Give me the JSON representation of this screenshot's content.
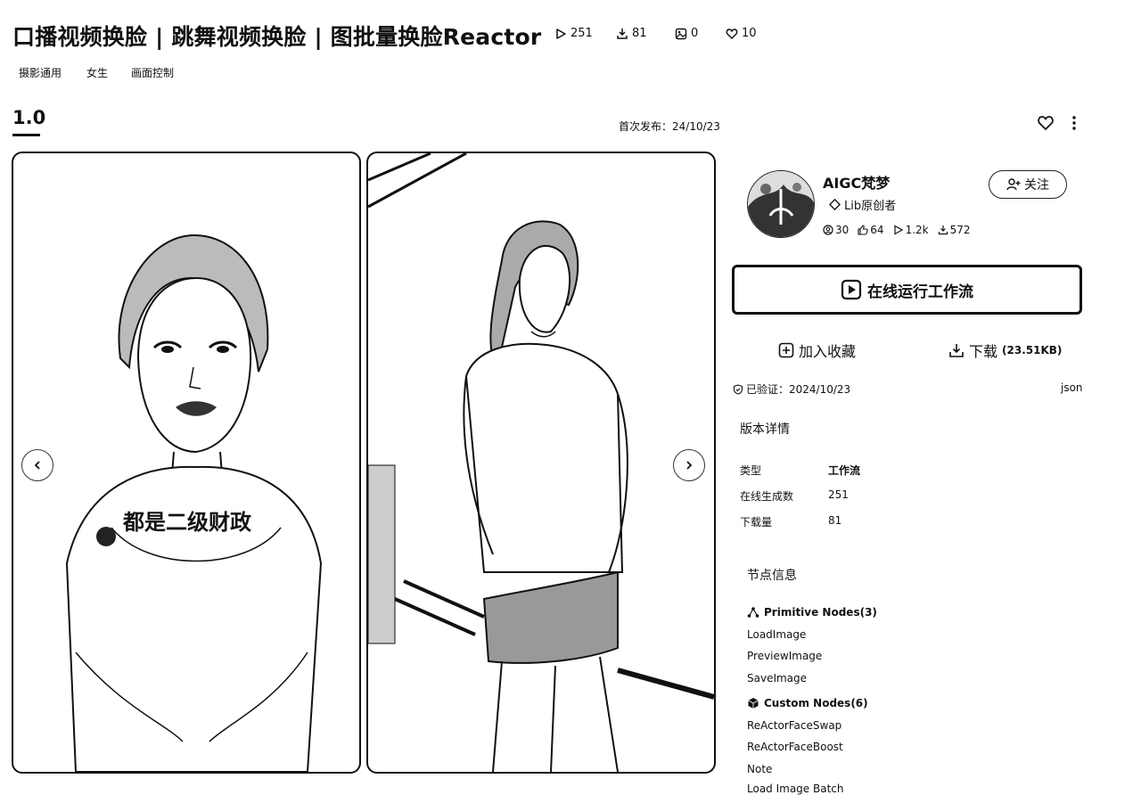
{
  "header": {
    "title": "口播视频换脸 | 跳舞视频换脸 | 图批量换脸Reactor",
    "stats": {
      "runs": "251",
      "downloads": "81",
      "images": "0",
      "likes": "10"
    },
    "tags": [
      "摄影通用",
      "女生",
      "画面控制"
    ]
  },
  "version": {
    "label": "1.0",
    "publish_label": "首次发布：",
    "publish_date": "24/10/23"
  },
  "gallery": {
    "caption": "都是二级财政"
  },
  "author": {
    "name": "AIGC梵梦",
    "badge": "Lib原创者",
    "stats": {
      "followers": "30",
      "likes": "64",
      "runs": "1.2k",
      "downloads": "572"
    },
    "follow_label": "关注"
  },
  "actions": {
    "run_label": "在线运行工作流",
    "favorite_label": "加入收藏",
    "download_label": "下载",
    "download_size": "(23.51KB)"
  },
  "verification": {
    "text": "已验证：2024/10/23",
    "format": "json"
  },
  "version_details": {
    "heading": "版本详情",
    "rows": [
      {
        "key": "类型",
        "value": "工作流"
      },
      {
        "key": "在线生成数",
        "value": "251"
      },
      {
        "key": "下载量",
        "value": "81"
      }
    ]
  },
  "node_info": {
    "heading": "节点信息",
    "groups": [
      {
        "label": "Primitive Nodes(3)",
        "items": [
          "LoadImage",
          "PreviewImage",
          "SaveImage"
        ]
      },
      {
        "label": "Custom Nodes(6)",
        "items": [
          "ReActorFaceSwap",
          "ReActorFaceBoost",
          "Note",
          "Load Image Batch"
        ]
      }
    ]
  }
}
